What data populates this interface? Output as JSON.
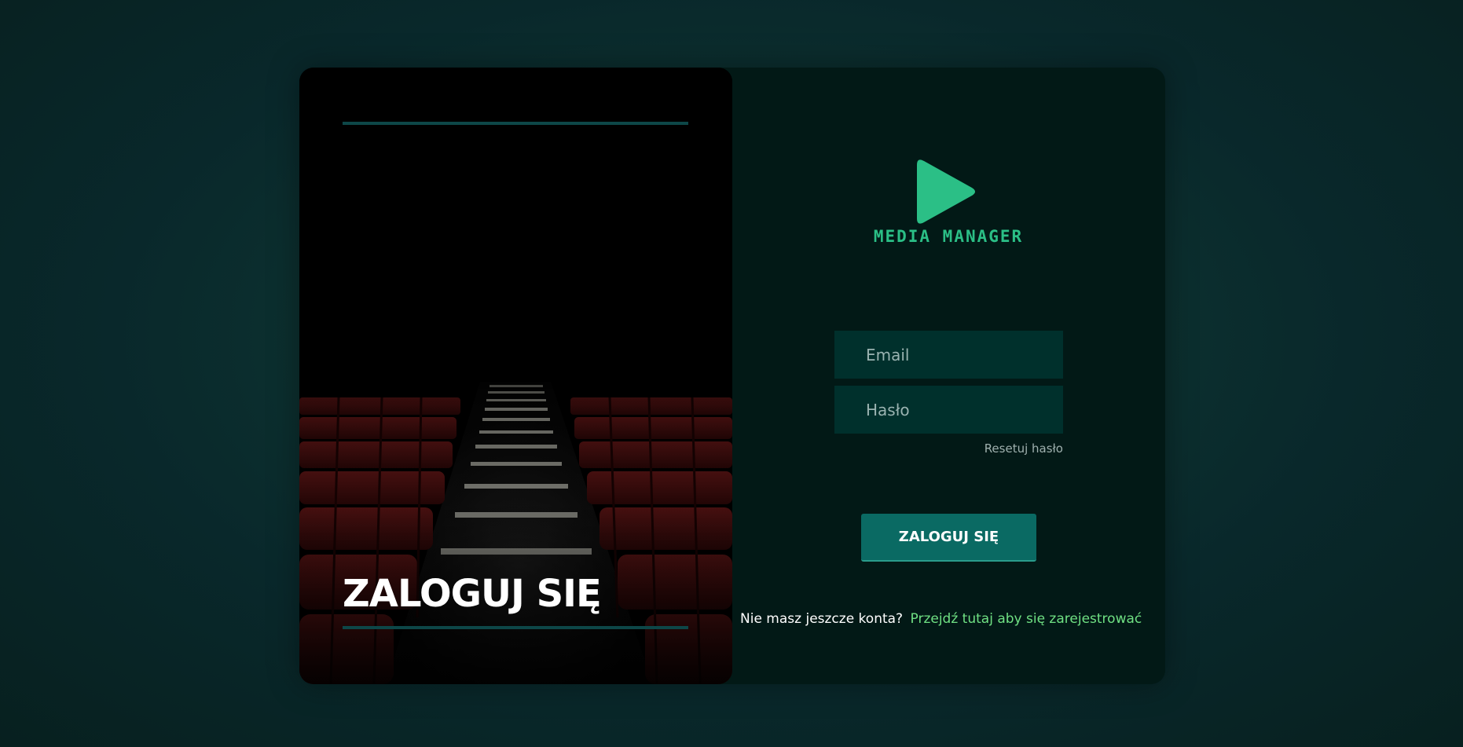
{
  "left_panel": {
    "title": "ZALOGUJ SIĘ"
  },
  "logo": {
    "text": "MEDIA MANAGER",
    "icon": "play-icon"
  },
  "form": {
    "email_placeholder": "Email",
    "password_placeholder": "Hasło",
    "reset_link": "Resetuj hasło",
    "login_button": "ZALOGUJ SIĘ"
  },
  "register": {
    "text": "Nie masz jeszcze konta?",
    "link": "Przejdź tutaj aby się zarejestrować"
  },
  "colors": {
    "accent_green": "#2bbf86",
    "button_teal": "#0a6a63",
    "link_green": "#6fe083",
    "input_bg": "#00302c"
  }
}
